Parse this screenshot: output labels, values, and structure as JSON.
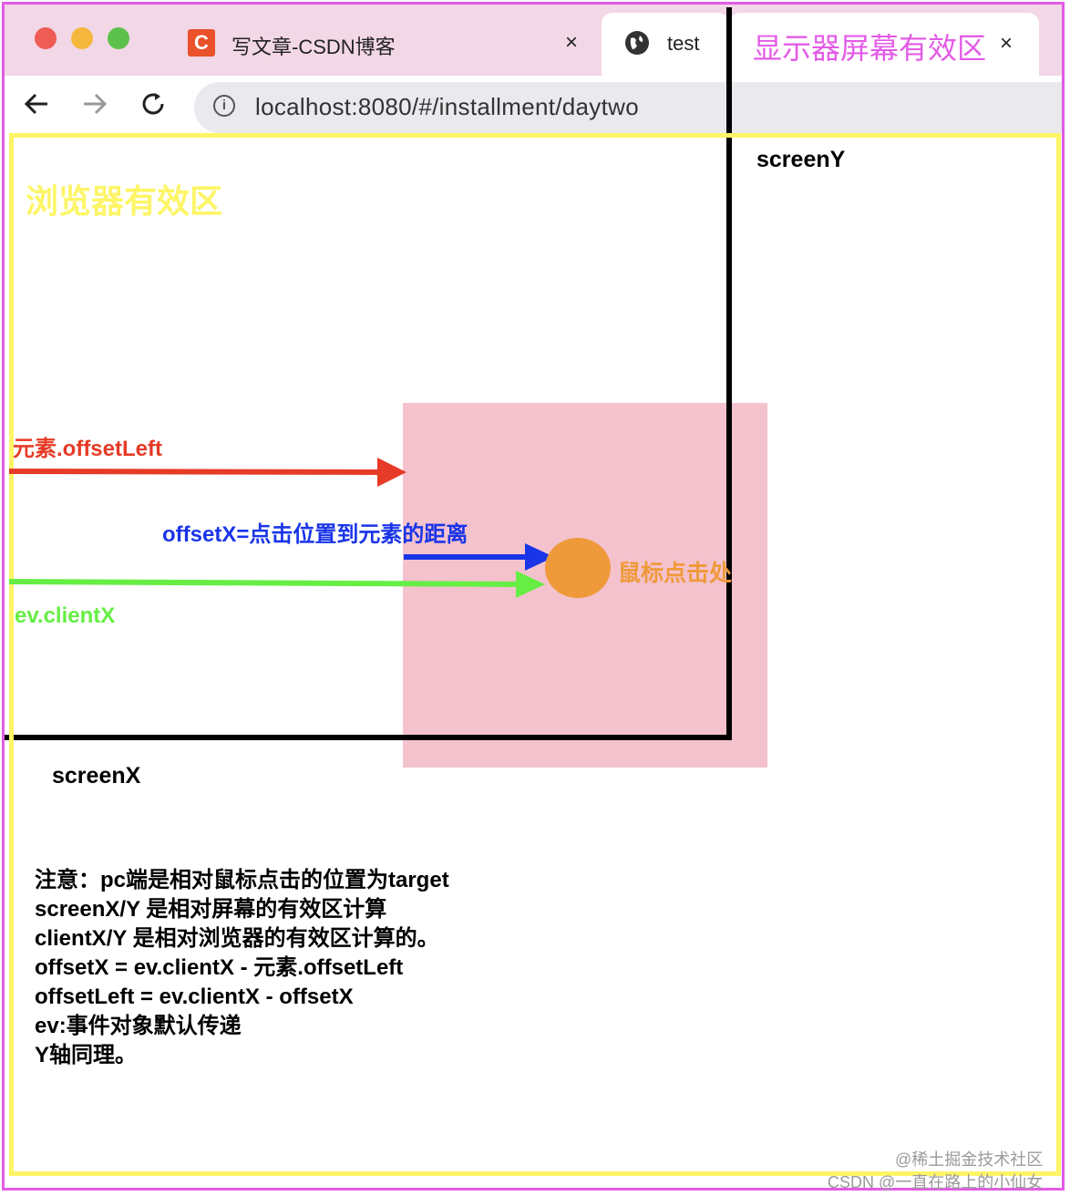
{
  "browser": {
    "tabs": [
      {
        "title": "写文章-CSDN博客",
        "close": "×",
        "logo_letter": "C"
      },
      {
        "title": "test",
        "close": "×"
      }
    ],
    "url": "localhost:8080/#/installment/daytwo"
  },
  "labels": {
    "screen_area": "显示器屏幕有效区",
    "browser_area": "浏览器有效区",
    "screen_y": "screenY",
    "screen_x": "screenX",
    "offset_left": "元素.offsetLeft",
    "offset_x": "offsetX=点击位置到元素的距离",
    "client_x": "ev.clientX",
    "click_point": "鼠标点击处"
  },
  "notes": [
    "注意：pc端是相对鼠标点击的位置为target",
    "screenX/Y 是相对屏幕的有效区计算",
    "clientX/Y 是相对浏览器的有效区计算的。",
    "offsetX = ev.clientX - 元素.offsetLeft",
    "offsetLeft = ev.clientX - offsetX",
    "ev:事件对象默认传递",
    "Y轴同理。"
  ],
  "watermarks": [
    "@稀土掘金技术社区",
    "CSDN @一直在路上的小仙女"
  ],
  "colors": {
    "screen_frame": "#e35be6",
    "browser_frame": "#fdf566",
    "element_box": "#f4c2cd",
    "offset_left_arrow": "#e63b26",
    "offset_x_arrow": "#1a35e8",
    "client_x_arrow": "#66ee44",
    "click_point": "#ef9a3a"
  }
}
